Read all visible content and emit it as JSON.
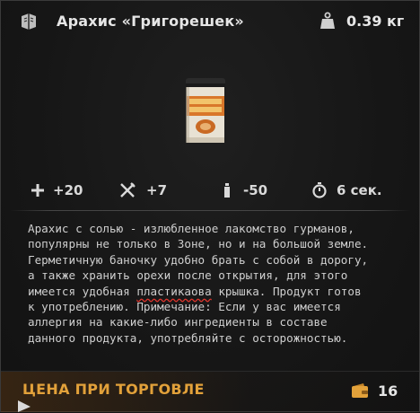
{
  "item": {
    "title": "Арахис «Григорешек»",
    "weight": "0.39 кг"
  },
  "stats": {
    "health": "+20",
    "satiety": "+7",
    "thirst": "-50",
    "use_time": "6 сек."
  },
  "description": {
    "line1": "Арахис с солью - излюбленное лакомство гурманов,",
    "line2": "популярны не только в Зоне, но и на большой земле.",
    "line3": "Герметичную баночку удобно брать с собой в дорогу,",
    "line4": "а также хранить орехи после открытия, для этого",
    "line5_before": "имеется удобная ",
    "line5_typo": "пластикаова",
    "line5_after": " крышка. Продукт готов",
    "line6": "к употреблению. Примечание: Если у вас имеется",
    "line7": "аллергия на какие-либо ингредиенты в составе",
    "line8": "данного продукта, употребляйте с осторожностью."
  },
  "footer": {
    "price_label": "ЦЕНА ПРИ ТОРГОВЛЕ",
    "price_value": "16"
  },
  "colors": {
    "accent": "#e2a13a",
    "typo_underline": "#e0342c"
  }
}
